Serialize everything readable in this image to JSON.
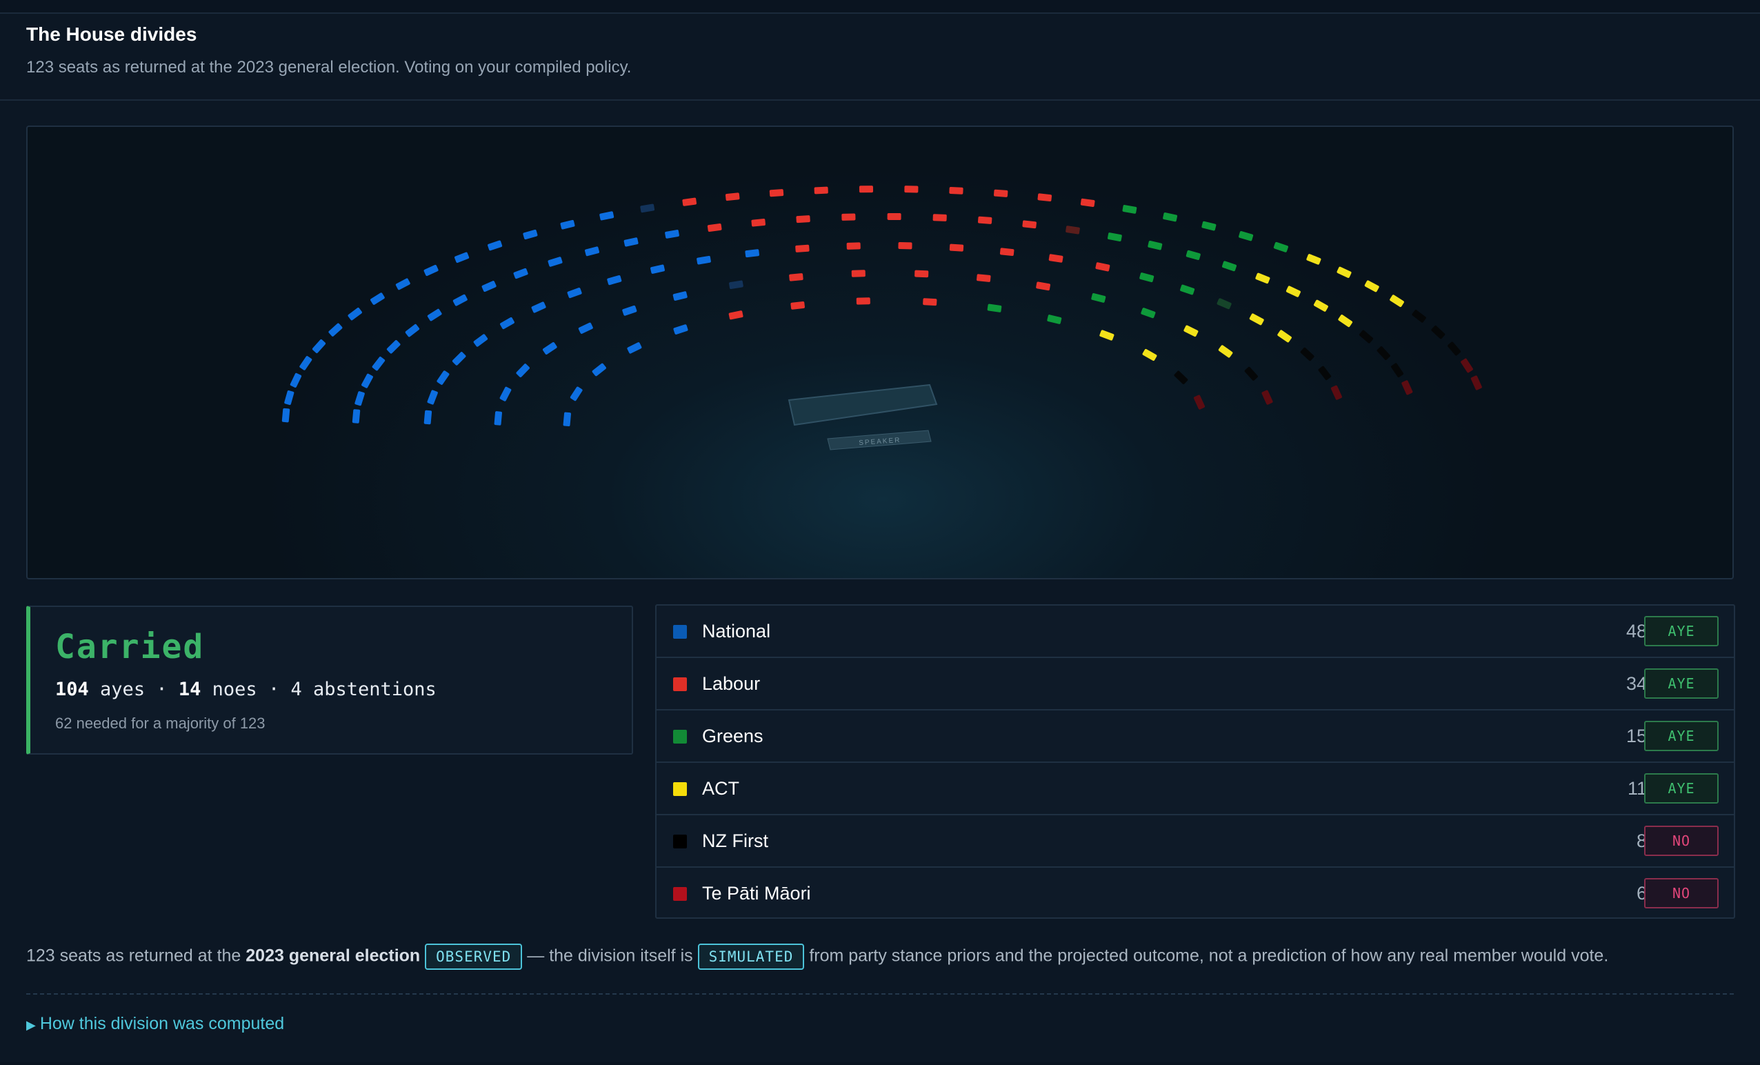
{
  "header": {
    "title": "The House divides",
    "subtitle": "123 seats as returned at the 2023 general election. Voting on your compiled policy."
  },
  "chamber": {
    "speaker_label": "SPEAKER",
    "rows": [
      [
        "N",
        "N",
        "N",
        "N",
        "N",
        "N",
        "N",
        "N",
        "N",
        "N",
        "N",
        "N",
        "N",
        "N",
        "N",
        "Nx",
        "L",
        "L",
        "L",
        "L",
        "L",
        "L",
        "L",
        "L",
        "L",
        "L",
        "G",
        "G",
        "G",
        "G",
        "G",
        "A",
        "A",
        "A",
        "A",
        "F",
        "F",
        "F",
        "M",
        "M"
      ],
      [
        "N",
        "N",
        "N",
        "N",
        "N",
        "N",
        "N",
        "N",
        "N",
        "N",
        "N",
        "N",
        "N",
        "N",
        "L",
        "L",
        "L",
        "L",
        "L",
        "L",
        "L",
        "L",
        "Lx",
        "G",
        "G",
        "G",
        "G",
        "A",
        "A",
        "A",
        "A",
        "F",
        "F",
        "F",
        "M"
      ],
      [
        "N",
        "N",
        "N",
        "N",
        "N",
        "N",
        "N",
        "N",
        "N",
        "N",
        "N",
        "N",
        "L",
        "L",
        "L",
        "L",
        "L",
        "L",
        "L",
        "G",
        "G",
        "Gx",
        "A",
        "A",
        "F",
        "F",
        "M"
      ],
      [
        "N",
        "N",
        "N",
        "N",
        "N",
        "N",
        "N",
        "Nx",
        "L",
        "L",
        "L",
        "L",
        "L",
        "G",
        "G",
        "A",
        "A",
        "F",
        "M"
      ],
      [
        "N",
        "N",
        "N",
        "N",
        "N",
        "L",
        "L",
        "L",
        "L",
        "G",
        "G",
        "A",
        "A",
        "F",
        "M"
      ]
    ]
  },
  "result": {
    "outcome": "Carried",
    "ayes_count": "104",
    "ayes_label": "ayes",
    "noes_count": "14",
    "noes_label": "noes",
    "abstentions": "4 abstentions",
    "separator": "·",
    "majority_note": "62 needed for a majority of 123"
  },
  "parties": [
    {
      "name": "National",
      "seats": "48",
      "vote": "AYE",
      "color": "#0a5bb5"
    },
    {
      "name": "Labour",
      "seats": "34",
      "vote": "AYE",
      "color": "#e02f27"
    },
    {
      "name": "Greens",
      "seats": "15",
      "vote": "AYE",
      "color": "#128a36"
    },
    {
      "name": "ACT",
      "seats": "11",
      "vote": "AYE",
      "color": "#f5dc0a"
    },
    {
      "name": "NZ First",
      "seats": "8",
      "vote": "NO",
      "color": "#000000"
    },
    {
      "name": "Te Pāti Māori",
      "seats": "6",
      "vote": "NO",
      "color": "#b3101c"
    }
  ],
  "seat_colors": {
    "N": "#0d6ee0",
    "Nx": "#13335a",
    "L": "#e8342c",
    "Lx": "#5a1e1c",
    "G": "#0e9a3a",
    "Gx": "#16452a",
    "A": "#f3e21a",
    "F": "#050708",
    "M": "#5c0c12"
  },
  "footnote": {
    "part1": "123 seats as returned at the",
    "bold": "2023 general election",
    "tag1": "OBSERVED",
    "part2": "— the division itself is",
    "tag2": "SIMULATED",
    "part3": "from party stance priors and the projected outcome, not a prediction of how any real member would vote."
  },
  "disclosure": {
    "label": "How this division was computed"
  }
}
